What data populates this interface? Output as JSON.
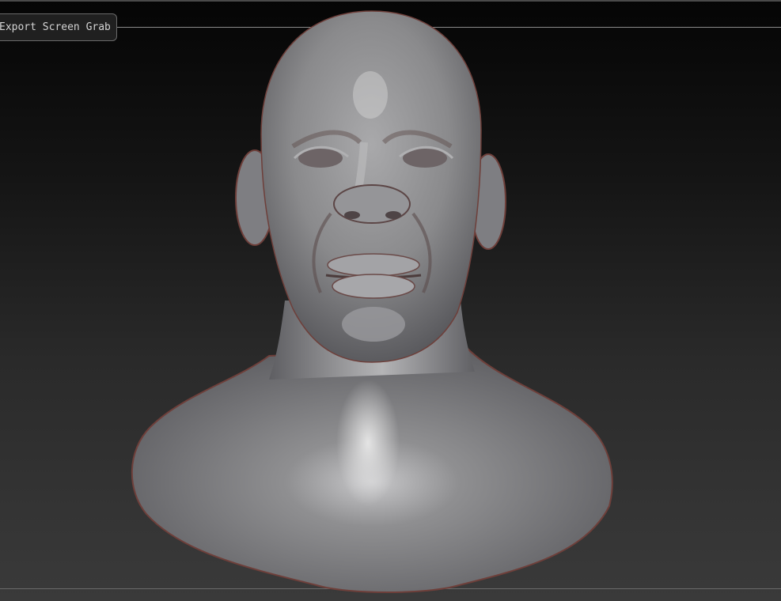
{
  "toolbar": {
    "export_button_label": "Export Screen Grab"
  },
  "colors": {
    "background_top": "#050505",
    "background_bottom": "#3a3a3a",
    "clay": "#8a8a8c",
    "clay_rim": "#7a4a45"
  },
  "viewport": {
    "model": "clay-bust"
  }
}
